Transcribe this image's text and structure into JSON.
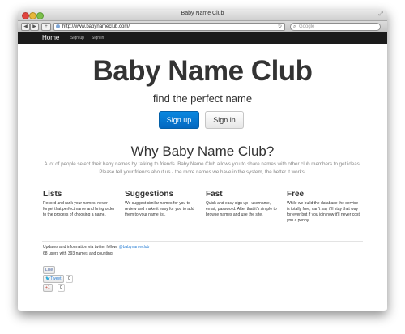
{
  "window": {
    "title": "Baby Name Club"
  },
  "browser": {
    "url": "http://www.babynameclub.com/",
    "search_placeholder": "Google",
    "back": "◀",
    "forward": "▶",
    "add": "+"
  },
  "navbar": {
    "brand": "Home",
    "links": [
      "Sign up",
      "Sign in"
    ]
  },
  "hero": {
    "title": "Baby Name Club",
    "subtitle": "find the perfect name",
    "signup_label": "Sign up",
    "signin_label": "Sign in"
  },
  "why": {
    "title": "Why Baby Name Club?",
    "text": "A lot of people select their baby names by talking to friends. Baby Name Club allows you to share names with other club members to get ideas. Please tell your friends about us - the more names we have in the system, the better it works!"
  },
  "features": [
    {
      "title": "Lists",
      "text": "Record and rank your names, never forget that perfect name and bring order to the process of choosing a name."
    },
    {
      "title": "Suggestions",
      "text": "We suggest similar names for you to review and make it easy for you to add them to your name list."
    },
    {
      "title": "Fast",
      "text": "Quick and easy sign up - username, email, password. After that it's simple to browse names and use the site."
    },
    {
      "title": "Free",
      "text": "While we build the database the service is totally free, can't say it'll stay that way for ever but if you join now it'll never cost you a penny."
    }
  ],
  "footer": {
    "updates_text": "Updates and information via twitter follow, ",
    "twitter_handle": "@babynameclub",
    "count_text": "68 users with 393 names and counting"
  },
  "social": {
    "like_label": "Like",
    "tweet_label": "Tweet",
    "tweet_count": "0",
    "plusone_label": "+1",
    "plusone_count": "0"
  },
  "colors": {
    "navbar_bg": "#1b1b1b",
    "primary_button": "#0a79d4",
    "link": "#2a7fd4"
  }
}
